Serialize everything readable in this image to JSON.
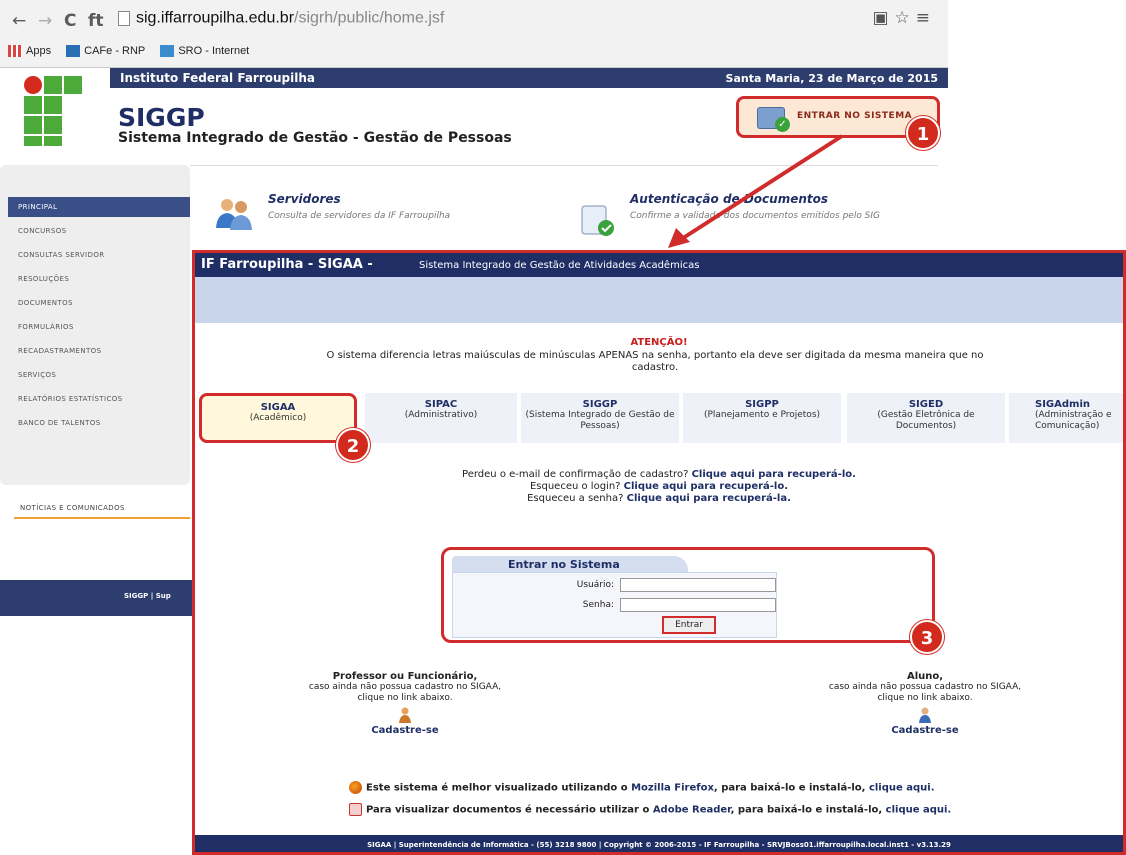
{
  "browser": {
    "nav_back": "←",
    "nav_forward": "→",
    "nav_reload": "C",
    "nav_home": "ft",
    "url_host": "sig.iffarroupilha.edu.br",
    "url_path": "/sigrh/public/home.jsf",
    "right_icons": "▣☆≡",
    "bookmarks": [
      {
        "label": "Apps"
      },
      {
        "label": "CAFe - RNP"
      },
      {
        "label": "SRO - Internet"
      }
    ]
  },
  "siggp": {
    "institution": "Instituto Federal Farroupilha",
    "date": "Santa Maria, 23 de Março de 2015",
    "title": "SIGGP",
    "subtitle": "Sistema Integrado de Gestão - Gestão de Pessoas",
    "entrar_label": "Entrar no sistema",
    "sidebar": [
      "Principal",
      "Concursos",
      "Consultas Servidor",
      "Resoluções",
      "Documentos",
      "Formulários",
      "Recadastramentos",
      "Serviços",
      "Relatórios Estatísticos",
      "Banco de Talentos"
    ],
    "noticias": "Notícias e Comunicados",
    "footer": "SIGGP | Sup",
    "services": [
      {
        "title": "Servidores",
        "desc": "Consulta de servidores da IF Farroupilha"
      },
      {
        "title": "Autenticação de Documentos",
        "desc": "Confirme a validade dos documentos emitidos pelo SIG"
      }
    ]
  },
  "sigaa": {
    "brand": "IF Farroupilha - SIGAA -",
    "tagline": "Sistema Integrado de Gestão de Atividades Acadêmicas",
    "atencao_title": "ATENÇÃO!",
    "atencao_msg": "O sistema diferencia letras maiúsculas de minúsculas APENAS na senha, portanto ela deve ser digitada da mesma maneira que no cadastro.",
    "systems": [
      {
        "name": "SIGAA",
        "desc": "(Acadêmico)"
      },
      {
        "name": "SIPAC",
        "desc": "(Administrativo)"
      },
      {
        "name": "SIGGP",
        "desc": "(Sistema Integrado de Gestão de Pessoas)"
      },
      {
        "name": "SIGPP",
        "desc": "(Planejamento e Projetos)"
      },
      {
        "name": "SIGED",
        "desc": "(Gestão Eletrônica de Documentos)"
      },
      {
        "name": "SIGAdmin",
        "desc": "(Administração e Comunicação)"
      }
    ],
    "recover": [
      {
        "q": "Perdeu o e-mail de confirmação de cadastro?",
        "link": "Clique aqui para recuperá-lo."
      },
      {
        "q": "Esqueceu o login?",
        "link": "Clique aqui para recuperá-lo."
      },
      {
        "q": "Esqueceu a senha?",
        "link": "Clique aqui para recuperá-la."
      }
    ],
    "login": {
      "title": "Entrar no Sistema",
      "user_label": "Usuário:",
      "pass_label": "Senha:",
      "user_value": "",
      "pass_value": "",
      "button": "Entrar"
    },
    "register": [
      {
        "title": "Professor ou Funcionário,",
        "l1": "caso ainda não possua cadastro no SIGAA,",
        "l2": "clique no link abaixo.",
        "link": "Cadastre-se"
      },
      {
        "title": "Aluno,",
        "l1": "caso ainda não possua cadastro no SIGAA,",
        "l2": "clique no link abaixo.",
        "link": "Cadastre-se"
      }
    ],
    "browser_note": {
      "pre": "Este sistema é melhor visualizado utilizando o ",
      "app": "Mozilla Firefox",
      "mid": ", para baixá-lo e instalá-lo, ",
      "link": "clique aqui."
    },
    "reader_note": {
      "pre": "Para visualizar documentos é necessário utilizar o ",
      "app": "Adobe Reader",
      "mid": ", para baixá-lo e instalá-lo, ",
      "link": "clique aqui."
    },
    "footer": "SIGAA | Superintendência de Informática - (55) 3218 9800 | Copyright © 2006-2015 - IF Farroupilha - SRVJBoss01.iffarroupilha.local.inst1 - v3.13.29"
  },
  "annotations": {
    "badge1": "1",
    "badge2": "2",
    "badge3": "3",
    "color": "#d22b2b"
  }
}
